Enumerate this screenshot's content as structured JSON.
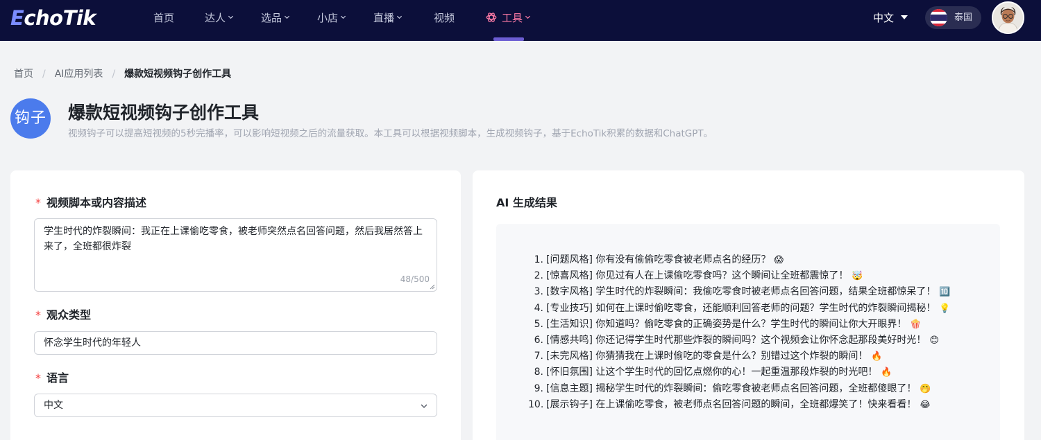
{
  "nav": {
    "logo_e": "E",
    "logo_rest": "choTik",
    "items": [
      {
        "label": "首页"
      },
      {
        "label": "达人"
      },
      {
        "label": "选品"
      },
      {
        "label": "小店"
      },
      {
        "label": "直播"
      },
      {
        "label": "视频"
      },
      {
        "label": "工具"
      }
    ],
    "language": "中文",
    "region": "泰国"
  },
  "breadcrumb": [
    "首页",
    "AI应用列表",
    "爆款短视频钩子创作工具"
  ],
  "header": {
    "badge": "钩子",
    "title": "爆款短视频钩子创作工具",
    "description": "视频钩子可以提高短视频的5秒完播率，可以影响短视频之后的流量获取。本工具可以根据视频脚本，生成视频钩子，基于EchoTik积累的数据和ChatGPT。"
  },
  "form": {
    "script_label": "视频脚本或内容描述",
    "script_value": "学生时代的炸裂瞬间：我正在上课偷吃零食，被老师突然点名回答问题，然后我居然答上来了，全班都很炸裂",
    "script_counter": "48/500",
    "audience_label": "观众类型",
    "audience_value": "怀念学生时代的年轻人",
    "language_label": "语言",
    "language_value": "中文",
    "required_mark": "*"
  },
  "result": {
    "title": "AI 生成结果",
    "items": [
      {
        "num": "1.",
        "text": "[问题风格] 你有没有偷偷吃零食被老师点名的经历？",
        "emoji": "😱"
      },
      {
        "num": "2.",
        "text": "[惊喜风格] 你见过有人在上课偷吃零食吗？这个瞬间让全班都震惊了！",
        "emoji": "🤯"
      },
      {
        "num": "3.",
        "text": "[数字风格] 学生时代的炸裂瞬间：我偷吃零食时被老师点名回答问题，结果全班都惊呆了！",
        "emoji": "🔟"
      },
      {
        "num": "4.",
        "text": "[专业技巧] 如何在上课时偷吃零食，还能顺利回答老师的问题？学生时代的炸裂瞬间揭秘！",
        "emoji": "💡"
      },
      {
        "num": "5.",
        "text": "[生活知识] 你知道吗？偷吃零食的正确姿势是什么？学生时代的瞬间让你大开眼界！",
        "emoji": "🍿"
      },
      {
        "num": "6.",
        "text": "[情感共鸣] 你还记得学生时代那些炸裂的瞬间吗？这个视频会让你怀念起那段美好时光！",
        "emoji": "😊"
      },
      {
        "num": "7.",
        "text": "[未完风格] 你猜猜我在上课时偷吃的零食是什么？别错过这个炸裂的瞬间！",
        "emoji": "🔥"
      },
      {
        "num": "8.",
        "text": "[怀旧氛围] 让这个学生时代的回忆点燃你的心！一起重温那段炸裂的时光吧！",
        "emoji": "🔥"
      },
      {
        "num": "9.",
        "text": "[信息主题] 揭秘学生时代的炸裂瞬间：偷吃零食被老师点名回答问题，全班都傻眼了！",
        "emoji": "🤭"
      },
      {
        "num": "10.",
        "text": "[展示钩子] 在上课偷吃零食，被老师点名回答问题的瞬间，全班都爆笑了！快来看看！",
        "emoji": "😂"
      }
    ]
  },
  "colors": {
    "nav_bg": "#0c0f3a",
    "accent": "#6c5dd3",
    "active_nav": "#ff7ba6",
    "badge_bg": "#4b7bec",
    "required": "#f53f3f"
  }
}
